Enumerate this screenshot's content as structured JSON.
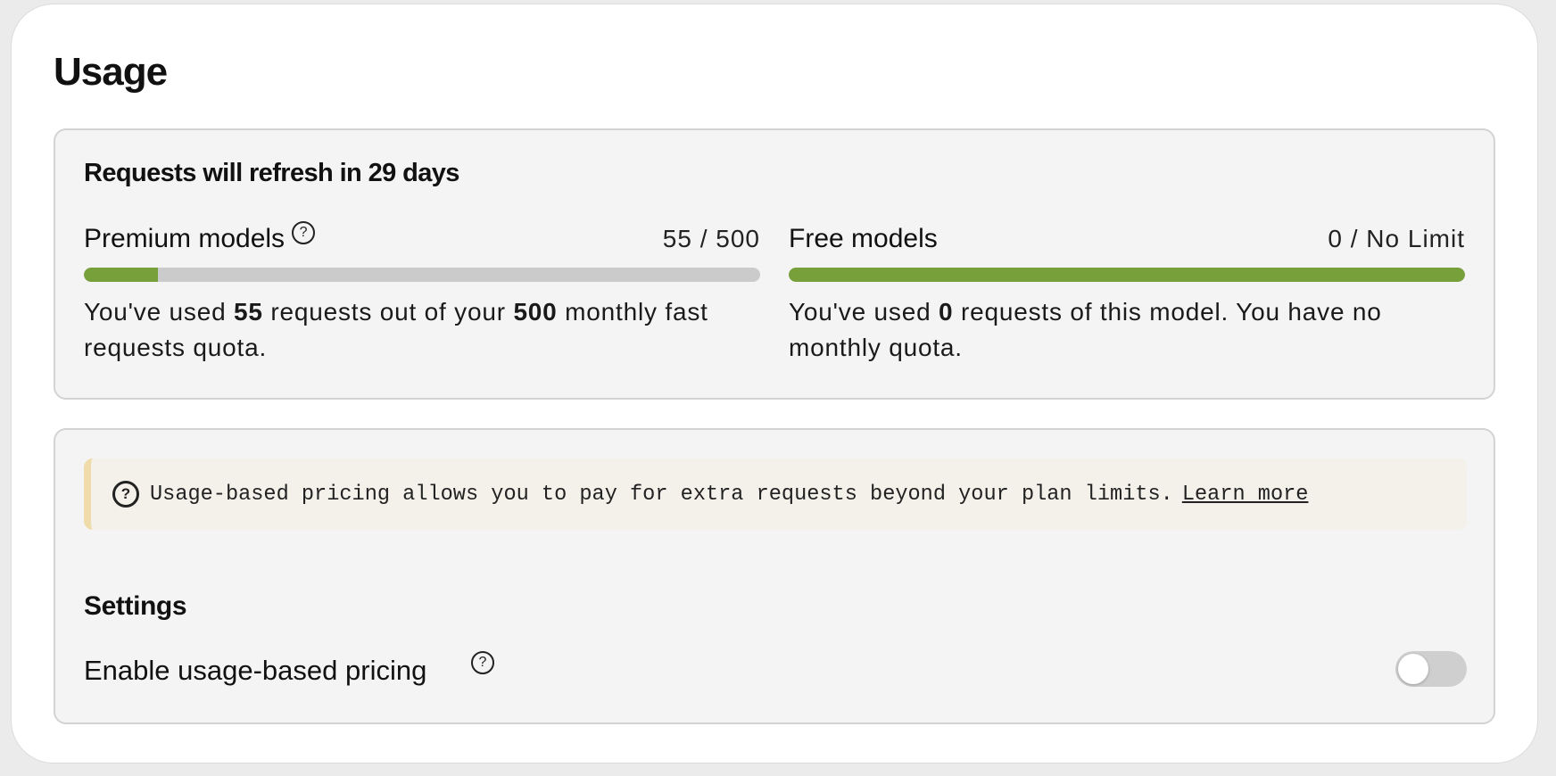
{
  "page": {
    "title": "Usage"
  },
  "usage": {
    "refresh_title": "Requests will refresh in 29 days",
    "premium": {
      "label": "Premium models",
      "count": "55 / 500",
      "used": 55,
      "limit": 500,
      "progress_fraction": 0.11,
      "desc_prefix": "You've used ",
      "desc_used": "55",
      "desc_middle": " requests out of your ",
      "desc_limit": "500",
      "desc_suffix": " monthly fast requests quota."
    },
    "free": {
      "label": "Free models",
      "count": "0 / No Limit",
      "used": 0,
      "progress_fraction": 1.0,
      "desc_prefix": "You've used ",
      "desc_used": "0",
      "desc_suffix": " requests of this model. You have no monthly quota."
    }
  },
  "pricing": {
    "info_text": "Usage-based pricing allows you to pay for extra requests beyond your plan limits.",
    "learn_more": "Learn more",
    "settings_title": "Settings",
    "toggle_label": "Enable usage-based pricing",
    "toggle_enabled": false
  },
  "icons": {
    "help": "question-circle-icon",
    "info": "question-circle-icon"
  },
  "colors": {
    "progress_fill": "#78a03a",
    "progress_track": "#cbcbcb",
    "banner_accent": "#efdcaa",
    "panel_bg": "#f4f4f4"
  }
}
